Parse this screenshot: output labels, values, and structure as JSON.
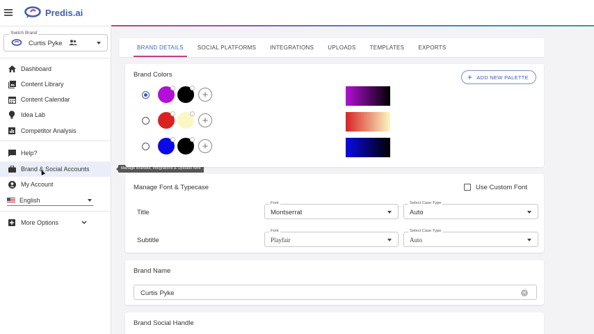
{
  "app": {
    "logo_text": "Predis.ai",
    "brand_color": "#3f5fae"
  },
  "brand_switcher": {
    "label": "Switch Brand",
    "value": "Curtis Pyke"
  },
  "sidebar": {
    "items": [
      {
        "label": "Dashboard",
        "icon": "home-icon"
      },
      {
        "label": "Content Library",
        "icon": "image-library-icon"
      },
      {
        "label": "Content Calendar",
        "icon": "calendar-icon"
      },
      {
        "label": "Idea Lab",
        "icon": "lightbulb-icon"
      },
      {
        "label": "Competitor Analysis",
        "icon": "chart-icon"
      },
      {
        "label": "Help?",
        "icon": "chat-icon"
      },
      {
        "label": "Brand & Social Accounts",
        "icon": "briefcase-icon",
        "active": true
      },
      {
        "label": "My Account",
        "icon": "account-icon"
      }
    ],
    "language": "English",
    "more_options": "More Options",
    "tooltip": "Manage Brandkit, Integrations & Uploads here"
  },
  "tabs": [
    {
      "label": "BRAND DETAILS",
      "active": true
    },
    {
      "label": "SOCIAL PLATFORMS"
    },
    {
      "label": "INTEGRATIONS"
    },
    {
      "label": "UPLOADS"
    },
    {
      "label": "TEMPLATES"
    },
    {
      "label": "EXPORTS"
    }
  ],
  "brand_colors": {
    "title": "Brand Colors",
    "add_palette_label": "ADD NEW PALETTE",
    "palettes": [
      {
        "selected": true,
        "colors": [
          "#b30fd6",
          "#000000"
        ]
      },
      {
        "selected": false,
        "colors": [
          "#d92323",
          "#fbf7c4"
        ]
      },
      {
        "selected": false,
        "colors": [
          "#0a0ae6",
          "#000000"
        ]
      }
    ]
  },
  "fonts": {
    "title": "Manage Font & Typecase",
    "custom_font_label": "Use Custom Font",
    "rows": [
      {
        "label": "Title",
        "font_label": "Font",
        "font": "Montserrat",
        "case_label": "Select Case Type",
        "case": "Auto"
      },
      {
        "label": "Subtitle",
        "font_label": "Font",
        "font": "Playfair",
        "case_label": "Select Case Type",
        "case": "Auto"
      }
    ]
  },
  "brand_name": {
    "title": "Brand Name",
    "value": "Curtis Pyke"
  },
  "brand_social": {
    "title": "Brand Social Handle"
  }
}
